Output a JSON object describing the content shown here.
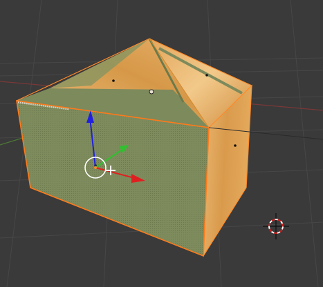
{
  "viewport": {
    "background": "#3a3a3a",
    "grid_color": "#4a4a4a",
    "x_axis_color": "#8a3a3a",
    "y_axis_color": "#5a8a3a"
  },
  "mesh": {
    "selection_outline": "#ff7a1a",
    "selected_face_color": "#7d8a5c",
    "wood_light": "#e8b36a",
    "wood_dark": "#c98a3a"
  },
  "gizmo": {
    "x_arrow_color": "#e02020",
    "y_arrow_color": "#30c030",
    "z_arrow_color": "#2020e0",
    "icon": "transform-manipulator-icon"
  },
  "cursor_3d": {
    "icon": "3d-cursor-icon"
  }
}
